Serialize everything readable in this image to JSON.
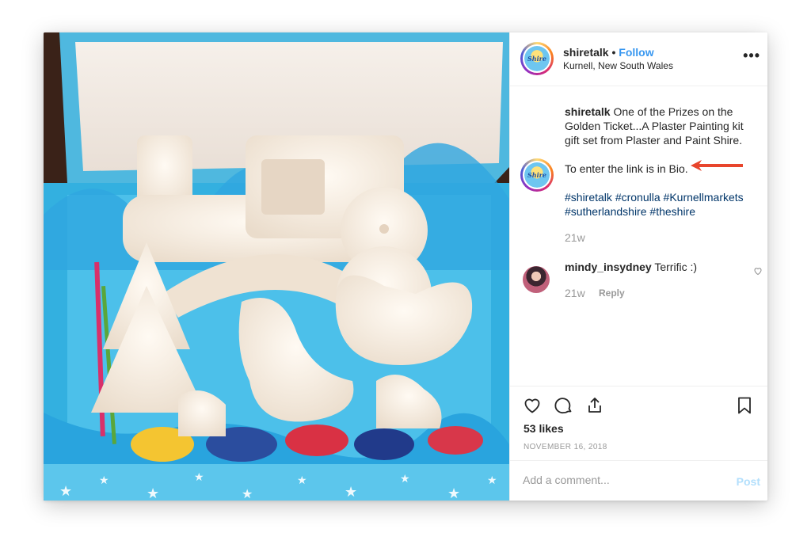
{
  "post": {
    "username": "shiretalk",
    "dot": "•",
    "follow_label": "Follow",
    "location": "Kurnell, New South Wales",
    "more_label": "•••",
    "avatar_text": "Shire"
  },
  "caption": {
    "username": "shiretalk",
    "text": "One of the Prizes on the Golden Ticket...A Plaster Painting kit gift set from Plaster and Paint Shire.",
    "line2": "To enter the link is in Bio.",
    "hashtags": [
      "#shiretalk",
      "#cronulla",
      "#Kurnellmarkets",
      "#sutherlandshire",
      "#theshire"
    ],
    "time": "21w"
  },
  "comments": [
    {
      "username": "mindy_insydney",
      "text": "Terrific :)",
      "time": "21w",
      "reply_label": "Reply"
    }
  ],
  "stats": {
    "likes": "53 likes",
    "date": "NOVEMBER 16, 2018"
  },
  "comment_box": {
    "placeholder": "Add a comment...",
    "post_label": "Post"
  },
  "colors": {
    "accent": "#3897f0",
    "hashtag": "#003569",
    "arrow": "#e8452c",
    "post_disabled": "#b2dffc"
  }
}
